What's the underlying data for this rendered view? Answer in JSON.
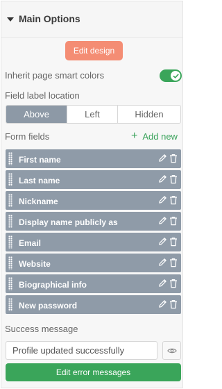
{
  "panel": {
    "title": "Main Options"
  },
  "edit_design_label": "Edit design",
  "inherit_colors": {
    "label": "Inherit page smart colors",
    "enabled": true
  },
  "label_location": {
    "label": "Field label location",
    "options": [
      "Above",
      "Left",
      "Hidden"
    ],
    "selected": "Above"
  },
  "form_fields": {
    "label": "Form fields",
    "add_new_label": "Add new",
    "items": [
      {
        "label": "First name"
      },
      {
        "label": "Last name"
      },
      {
        "label": "Nickname"
      },
      {
        "label": "Display name publicly as"
      },
      {
        "label": "Email"
      },
      {
        "label": "Website"
      },
      {
        "label": "Biographical info"
      },
      {
        "label": "New password"
      }
    ]
  },
  "success_message": {
    "label": "Success message",
    "value": "Profile updated successfully"
  },
  "edit_error_messages_label": "Edit error messages",
  "colors": {
    "accent_green": "#3aa55a",
    "accent_coral": "#f48d74",
    "field_bg": "#8f9ba8"
  },
  "icons": {
    "caret": "caret-down-icon",
    "edit": "pencil-icon",
    "delete": "trash-icon",
    "visibility": "eye-icon",
    "toggle": "check-icon",
    "drag": "drag-handle-icon"
  }
}
